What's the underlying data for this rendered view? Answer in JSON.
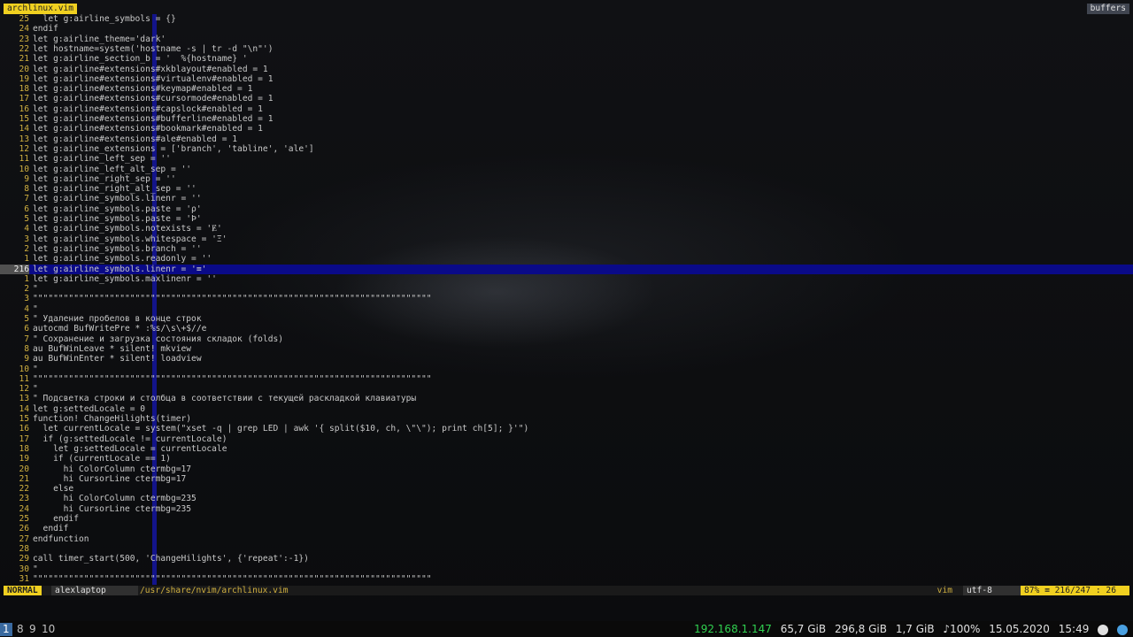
{
  "tabline": {
    "active_tab": "archlinux.vim",
    "buffers_label": "buffers"
  },
  "editor": {
    "lines": [
      {
        "num": "25",
        "text": "  let g:airline_symbols = {}"
      },
      {
        "num": "24",
        "text": "endif"
      },
      {
        "num": "23",
        "text": "let g:airline_theme='dark'"
      },
      {
        "num": "22",
        "text": "let hostname=system('hostname -s | tr -d \"\\n\"')"
      },
      {
        "num": "21",
        "text": "let g:airline_section_b = '  %{hostname} '"
      },
      {
        "num": "20",
        "text": "let g:airline#extensions#xkblayout#enabled = 1"
      },
      {
        "num": "19",
        "text": "let g:airline#extensions#virtualenv#enabled = 1"
      },
      {
        "num": "18",
        "text": "let g:airline#extensions#keymap#enabled = 1"
      },
      {
        "num": "17",
        "text": "let g:airline#extensions#cursormode#enabled = 1"
      },
      {
        "num": "16",
        "text": "let g:airline#extensions#capslock#enabled = 1"
      },
      {
        "num": "15",
        "text": "let g:airline#extensions#bufferline#enabled = 1"
      },
      {
        "num": "14",
        "text": "let g:airline#extensions#bookmark#enabled = 1"
      },
      {
        "num": "13",
        "text": "let g:airline#extensions#ale#enabled = 1"
      },
      {
        "num": "12",
        "text": "let g:airline_extensions = ['branch', 'tabline', 'ale']"
      },
      {
        "num": "11",
        "text": "let g:airline_left_sep = ''"
      },
      {
        "num": "10",
        "text": "let g:airline_left_alt_sep = ''"
      },
      {
        "num": "9",
        "text": "let g:airline_right_sep = ''"
      },
      {
        "num": "8",
        "text": "let g:airline_right_alt_sep = ''"
      },
      {
        "num": "7",
        "text": "let g:airline_symbols.linenr = ''"
      },
      {
        "num": "6",
        "text": "let g:airline_symbols.paste = 'ρ'"
      },
      {
        "num": "5",
        "text": "let g:airline_symbols.paste = 'Þ'"
      },
      {
        "num": "4",
        "text": "let g:airline_symbols.notexists = 'Ɇ'"
      },
      {
        "num": "3",
        "text": "let g:airline_symbols.whitespace = 'Ξ'"
      },
      {
        "num": "2",
        "text": "let g:airline_symbols.branch = ''"
      },
      {
        "num": "1",
        "text": "let g:airline_symbols.readonly = ''"
      },
      {
        "num": "216",
        "text": "let g:airline_symbols.linenr = '≡'"
      },
      {
        "num": "1",
        "text": "let g:airline_symbols.maxlinenr = ''"
      },
      {
        "num": "2",
        "text": "\""
      },
      {
        "num": "3",
        "text": "\"\"\"\"\"\"\"\"\"\"\"\"\"\"\"\"\"\"\"\"\"\"\"\"\"\"\"\"\"\"\"\"\"\"\"\"\"\"\"\"\"\"\"\"\"\"\"\"\"\"\"\"\"\"\"\"\"\"\"\"\"\"\"\"\"\"\"\"\"\"\"\"\"\"\"\"\"\""
      },
      {
        "num": "4",
        "text": "\""
      },
      {
        "num": "5",
        "text": "\" Удаление пробелов в конце строк"
      },
      {
        "num": "6",
        "text": "autocmd BufWritePre * :%s/\\s\\+$//e"
      },
      {
        "num": "7",
        "text": "\" Сохранение и загрузка состояния складок (folds)"
      },
      {
        "num": "8",
        "text": "au BufWinLeave * silent! mkview"
      },
      {
        "num": "9",
        "text": "au BufWinEnter * silent! loadview"
      },
      {
        "num": "10",
        "text": "\""
      },
      {
        "num": "11",
        "text": "\"\"\"\"\"\"\"\"\"\"\"\"\"\"\"\"\"\"\"\"\"\"\"\"\"\"\"\"\"\"\"\"\"\"\"\"\"\"\"\"\"\"\"\"\"\"\"\"\"\"\"\"\"\"\"\"\"\"\"\"\"\"\"\"\"\"\"\"\"\"\"\"\"\"\"\"\"\""
      },
      {
        "num": "12",
        "text": "\""
      },
      {
        "num": "13",
        "text": "\" Подсветка строки и столбца в соответствии с текущей раскладкой клавиатуры"
      },
      {
        "num": "14",
        "text": "let g:settedLocale = 0"
      },
      {
        "num": "15",
        "text": "function! ChangeHilights(timer)"
      },
      {
        "num": "16",
        "text": "  let currentLocale = system(\"xset -q | grep LED | awk '{ split($10, ch, \\\"\\\"); print ch[5]; }'\")"
      },
      {
        "num": "17",
        "text": "  if (g:settedLocale != currentLocale)"
      },
      {
        "num": "18",
        "text": "    let g:settedLocale = currentLocale"
      },
      {
        "num": "19",
        "text": "    if (currentLocale == 1)"
      },
      {
        "num": "20",
        "text": "      hi ColorColumn ctermbg=17"
      },
      {
        "num": "21",
        "text": "      hi CursorLine ctermbg=17"
      },
      {
        "num": "22",
        "text": "    else"
      },
      {
        "num": "23",
        "text": "      hi ColorColumn ctermbg=235"
      },
      {
        "num": "24",
        "text": "      hi CursorLine ctermbg=235"
      },
      {
        "num": "25",
        "text": "    endif"
      },
      {
        "num": "26",
        "text": "  endif"
      },
      {
        "num": "27",
        "text": "endfunction"
      },
      {
        "num": "28",
        "text": ""
      },
      {
        "num": "29",
        "text": "call timer_start(500, 'ChangeHilights', {'repeat':-1})"
      },
      {
        "num": "30",
        "text": "\""
      },
      {
        "num": "31",
        "text": "\"\"\"\"\"\"\"\"\"\"\"\"\"\"\"\"\"\"\"\"\"\"\"\"\"\"\"\"\"\"\"\"\"\"\"\"\"\"\"\"\"\"\"\"\"\"\"\"\"\"\"\"\"\"\"\"\"\"\"\"\"\"\"\"\"\"\"\"\"\"\"\"\"\"\"\"\"\""
      }
    ]
  },
  "statusline": {
    "mode": "NORMAL",
    "hostname": "alexlaptop",
    "filepath": "/usr/share/nvim/archlinux.vim",
    "filetype": "vim",
    "encoding": "utf-8",
    "position": "87% ≡ 216/247 : 26"
  },
  "bar": {
    "workspaces": [
      "1",
      "8",
      "9",
      "10"
    ],
    "active_workspace": "1",
    "ip": "192.168.1.147",
    "disk1": "65,7 GiB",
    "disk2": "296,8 GiB",
    "mem": "1,7 GiB",
    "volume": "♪100%",
    "date": "15.05.2020",
    "time": "15:49"
  }
}
